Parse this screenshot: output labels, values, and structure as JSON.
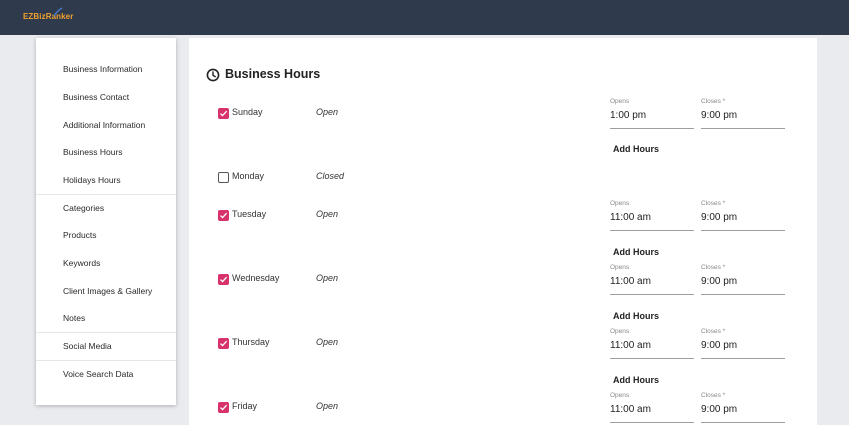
{
  "app": {
    "logo_text": "EZBizRanker"
  },
  "sidebar": {
    "items": [
      {
        "label": "Business Information"
      },
      {
        "label": "Business Contact"
      },
      {
        "label": "Additional Information"
      },
      {
        "label": "Business Hours"
      },
      {
        "label": "Holidays Hours"
      },
      {
        "label": "Categories"
      },
      {
        "label": "Products"
      },
      {
        "label": "Keywords"
      },
      {
        "label": "Client Images & Gallery"
      },
      {
        "label": "Notes"
      },
      {
        "label": "Social Media"
      },
      {
        "label": "Voice Search Data"
      }
    ]
  },
  "main": {
    "title": "Business Hours",
    "opens_label": "Opens",
    "closes_label": "Closes *",
    "add_hours_label": "Add Hours",
    "days": [
      {
        "name": "Sunday",
        "checked": true,
        "status": "Open",
        "opens": "1:00 pm",
        "closes": "9:00 pm"
      },
      {
        "name": "Monday",
        "checked": false,
        "status": "Closed"
      },
      {
        "name": "Tuesday",
        "checked": true,
        "status": "Open",
        "opens": "11:00 am",
        "closes": "9:00 pm"
      },
      {
        "name": "Wednesday",
        "checked": true,
        "status": "Open",
        "opens": "11:00 am",
        "closes": "9:00 pm"
      },
      {
        "name": "Thursday",
        "checked": true,
        "status": "Open",
        "opens": "11:00 am",
        "closes": "9:00 pm"
      },
      {
        "name": "Friday",
        "checked": true,
        "status": "Open",
        "opens": "11:00 am",
        "closes": "9:00 pm"
      }
    ]
  },
  "colors": {
    "topbar": "#2f3b4c",
    "accent": "#d8326c",
    "logo": "#f0a030"
  },
  "icons": {
    "title_icon": "clock-icon",
    "checkbox_checked": "checkbox-checked-icon",
    "checkbox_unchecked": "checkbox-unchecked-icon"
  }
}
